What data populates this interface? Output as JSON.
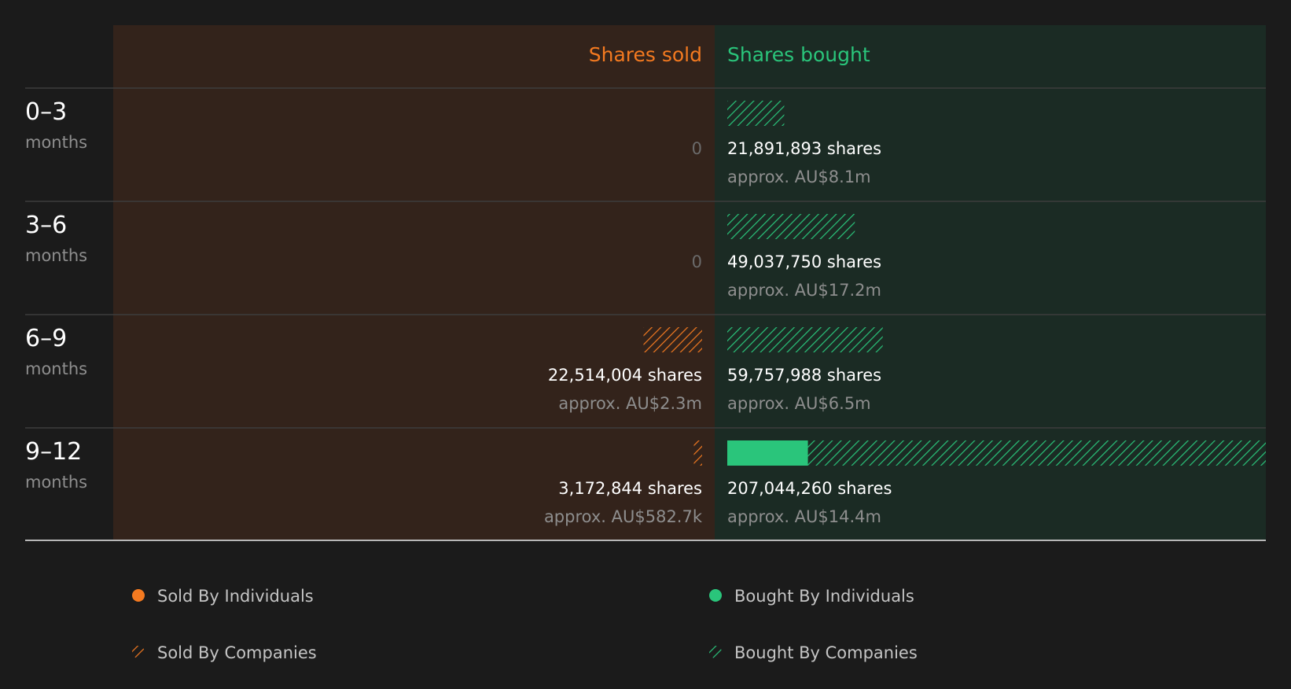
{
  "colors": {
    "background": "#1b1b1b",
    "sold_panel": "#33231b",
    "bought_panel": "#1b2b24",
    "sold_accent": "#f47a20",
    "bought_accent": "#2ac57b",
    "divider": "#3d3d3d",
    "baseline": "#b8b8b8",
    "primary_text": "#ffffff",
    "secondary_text": "#8e8e8e",
    "zero_text": "#6b6b6b",
    "legend_text": "#c4c4c4"
  },
  "chart_data": {
    "type": "bar",
    "headers": {
      "sold": "Shares sold",
      "bought": "Shares bought"
    },
    "categories": [
      {
        "period": "0–3",
        "unit": "months"
      },
      {
        "period": "3–6",
        "unit": "months"
      },
      {
        "period": "6–9",
        "unit": "months"
      },
      {
        "period": "9–12",
        "unit": "months"
      }
    ],
    "sold": [
      {
        "individuals": 0,
        "companies": 0,
        "shares_label": "0",
        "value_label": ""
      },
      {
        "individuals": 0,
        "companies": 0,
        "shares_label": "0",
        "value_label": ""
      },
      {
        "individuals": 0,
        "companies": 22514004,
        "shares_label": "22,514,004 shares",
        "value_label": "approx. AU$2.3m"
      },
      {
        "individuals": 0,
        "companies": 3172844,
        "shares_label": "3,172,844 shares",
        "value_label": "approx. AU$582.7k"
      }
    ],
    "bought": [
      {
        "individuals": 0,
        "companies": 21891893,
        "shares_label": "21,891,893 shares",
        "value_label": "approx. AU$8.1m"
      },
      {
        "individuals": 0,
        "companies": 49037750,
        "shares_label": "49,037,750 shares",
        "value_label": "approx. AU$17.2m"
      },
      {
        "individuals": 0,
        "companies": 59757988,
        "shares_label": "59,757,988 shares",
        "value_label": "approx. AU$6.5m"
      },
      {
        "individuals": 31000000,
        "companies": 176044260,
        "shares_label": "207,044,260 shares",
        "value_label": "approx. AU$14.4m"
      }
    ],
    "scale_max": 207044260,
    "legend": {
      "position": "bottom",
      "entries": [
        {
          "key": "sold_individuals",
          "label": "Sold By Individuals"
        },
        {
          "key": "bought_individuals",
          "label": "Bought By Individuals"
        },
        {
          "key": "sold_companies",
          "label": "Sold By Companies"
        },
        {
          "key": "bought_companies",
          "label": "Bought By Companies"
        }
      ]
    }
  }
}
